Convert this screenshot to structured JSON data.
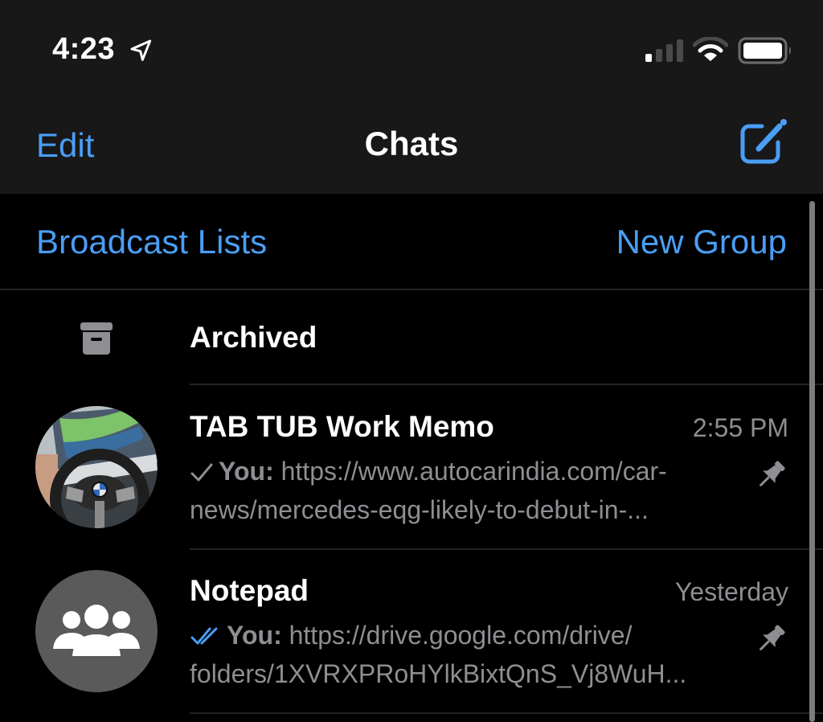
{
  "status_bar": {
    "time": "4:23",
    "location_icon": "location-arrow-icon",
    "signal_icon": "cellular-signal-icon",
    "signal_bars_active": 1,
    "signal_bars_total": 4,
    "wifi_icon": "wifi-icon",
    "battery_icon": "battery-icon",
    "battery_level": 1.0
  },
  "nav": {
    "edit_label": "Edit",
    "title": "Chats",
    "compose_icon": "compose-icon"
  },
  "actions": {
    "broadcast_label": "Broadcast Lists",
    "new_group_label": "New Group"
  },
  "archived": {
    "icon": "archive-box-icon",
    "label": "Archived"
  },
  "chats": [
    {
      "name": "TAB TUB Work Memo",
      "time": "2:55 PM",
      "status": "sent",
      "status_icon": "single-check-icon",
      "sender": "You:",
      "preview_line1": " https://www.autocarindia.com/car-",
      "preview_line2": "news/mercedes-eqg-likely-to-debut-in-...",
      "pinned": true,
      "avatar": "photo-avatar"
    },
    {
      "name": "Notepad",
      "time": "Yesterday",
      "status": "read",
      "status_icon": "double-check-icon",
      "sender": "You:",
      "preview_line1": " https://drive.google.com/drive/",
      "preview_line2": "folders/1XVRXPRoHYlkBixtQnS_Vj8WuH...",
      "pinned": true,
      "avatar": "group-avatar"
    }
  ],
  "colors": {
    "accent": "#4a9ef4",
    "nav_background": "#181818",
    "background": "#000000",
    "secondary_text": "#8e8e93",
    "separator": "#222222"
  }
}
